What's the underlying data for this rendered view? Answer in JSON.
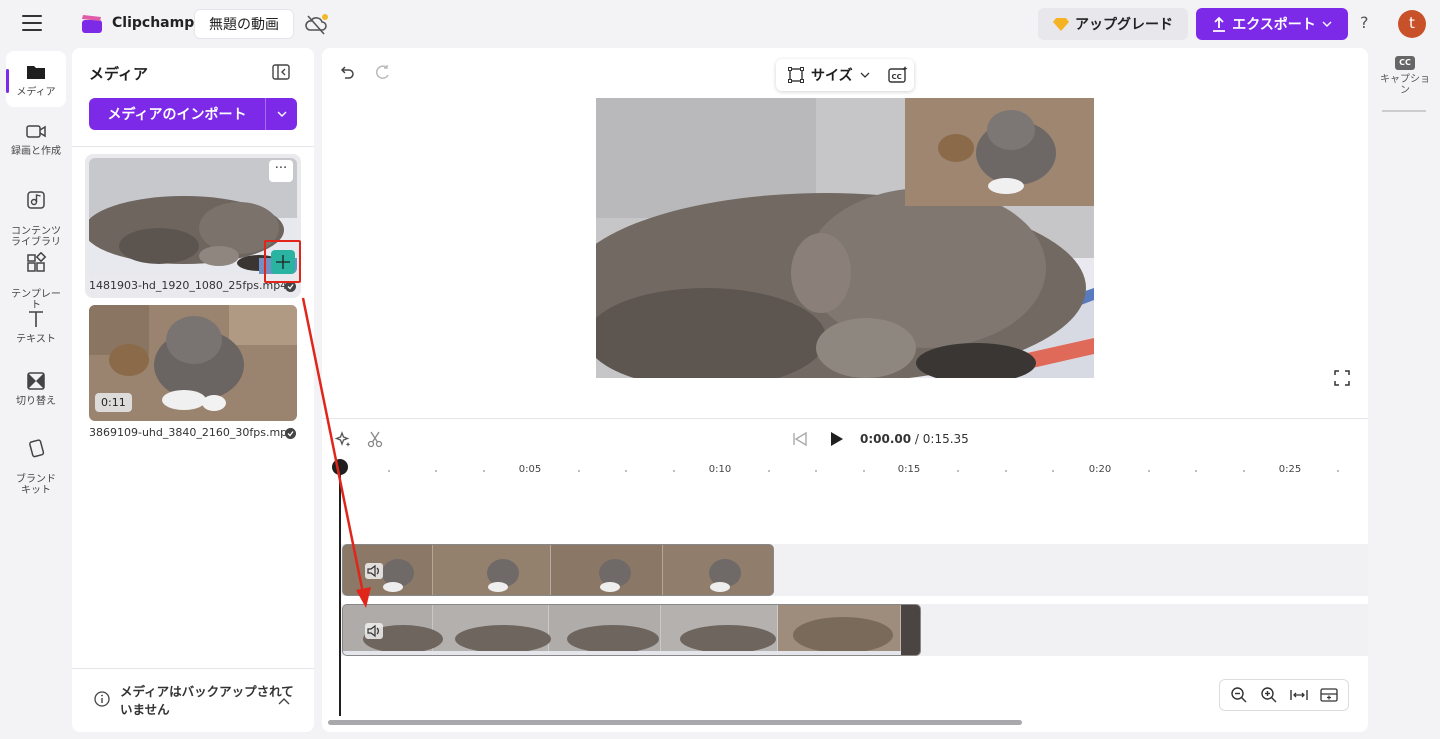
{
  "header": {
    "app_name": "Clipchamp",
    "project_title": "無題の動画",
    "upgrade_label": "アップグレード",
    "export_label": "エクスポート",
    "help_label": "?",
    "avatar_initial": "t",
    "accent_color": "#7d2ae8"
  },
  "rail": {
    "items": [
      {
        "label": "メディア",
        "icon": "folder-icon"
      },
      {
        "label": "録画と作成",
        "icon": "video-camera-icon"
      },
      {
        "label": "コンテンツ\nライブラリ",
        "icon": "library-icon"
      },
      {
        "label": "テンプレー\nト",
        "icon": "templates-icon"
      },
      {
        "label": "テキスト",
        "icon": "text-icon"
      },
      {
        "label": "切り替え",
        "icon": "transitions-icon"
      },
      {
        "label": "ブランド\nキット",
        "icon": "brand-kit-icon"
      }
    ]
  },
  "media_panel": {
    "title": "メディア",
    "import_label": "メディアのインポート",
    "items": [
      {
        "file_name": "1481903-hd_1920_1080_25fps.mp4",
        "more_label": "···"
      },
      {
        "file_name": "3869109-uhd_3840_2160_30fps.mp4",
        "duration": "0:11"
      }
    ],
    "backup_text": "メディアはバックアップされていません"
  },
  "editor": {
    "size_label": "サイズ",
    "time_current": "0:00.00",
    "time_separator": " / ",
    "time_total": "0:15.35",
    "ruler_labels": [
      "0:05",
      "0:10",
      "0:15",
      "0:20",
      "0:25"
    ]
  },
  "right_rail": {
    "caption_badge": "CC",
    "caption_label": "キャプショ\nン"
  }
}
